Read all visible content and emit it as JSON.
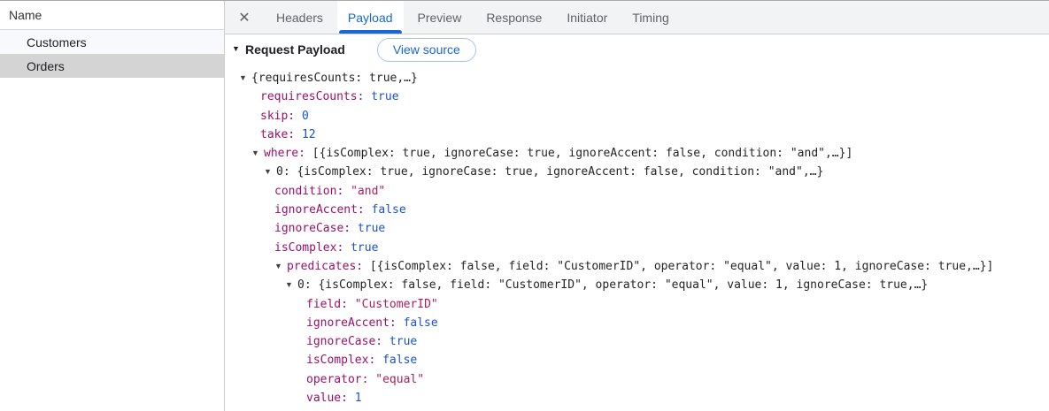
{
  "sidebar": {
    "header": "Name",
    "items": [
      {
        "label": "Customers",
        "selected": false
      },
      {
        "label": "Orders",
        "selected": true
      }
    ]
  },
  "tabs": {
    "items": [
      {
        "label": "Headers",
        "active": false
      },
      {
        "label": "Payload",
        "active": true
      },
      {
        "label": "Preview",
        "active": false
      },
      {
        "label": "Response",
        "active": false
      },
      {
        "label": "Initiator",
        "active": false
      },
      {
        "label": "Timing",
        "active": false
      }
    ]
  },
  "icons": {
    "close": "✕",
    "expanded_arrow": "▼"
  },
  "payload_section": {
    "title": "Request Payload",
    "view_source_label": "View source"
  },
  "colors": {
    "accent_blue": "#1967d2",
    "tree_key": "#99116d",
    "tree_string": "#b01e53",
    "tree_number_bool": "#1a53c8",
    "tree_plain": "#242424",
    "selected_row_bg": "#d4d4d4",
    "tabbar_bg": "#f1f3f4",
    "view_source_border": "#a3c6f5"
  },
  "payload_tree": {
    "rows": [
      {
        "indent": 16,
        "arrow": true,
        "parts": [
          {
            "text": "{requiresCounts: true,…}",
            "type": "plain"
          }
        ]
      },
      {
        "indent": 40,
        "arrow": false,
        "parts": [
          {
            "text": "requiresCounts: ",
            "type": "key"
          },
          {
            "text": "true",
            "type": "bool"
          }
        ]
      },
      {
        "indent": 40,
        "arrow": false,
        "parts": [
          {
            "text": "skip: ",
            "type": "key"
          },
          {
            "text": "0",
            "type": "num"
          }
        ]
      },
      {
        "indent": 40,
        "arrow": false,
        "parts": [
          {
            "text": "take: ",
            "type": "key"
          },
          {
            "text": "12",
            "type": "num"
          }
        ]
      },
      {
        "indent": 30,
        "arrow": true,
        "parts": [
          {
            "text": "where: ",
            "type": "key"
          },
          {
            "text": "[{isComplex: true, ignoreCase: true, ignoreAccent: false, condition: \"and\",…}]",
            "type": "plain"
          }
        ]
      },
      {
        "indent": 44,
        "arrow": true,
        "parts": [
          {
            "text": "0: {isComplex: true, ignoreCase: true, ignoreAccent: false, condition: \"and\",…}",
            "type": "plain"
          }
        ]
      },
      {
        "indent": 56,
        "arrow": false,
        "parts": [
          {
            "text": "condition: ",
            "type": "key"
          },
          {
            "text": "\"and\"",
            "type": "str"
          }
        ]
      },
      {
        "indent": 56,
        "arrow": false,
        "parts": [
          {
            "text": "ignoreAccent: ",
            "type": "key"
          },
          {
            "text": "false",
            "type": "bool"
          }
        ]
      },
      {
        "indent": 56,
        "arrow": false,
        "parts": [
          {
            "text": "ignoreCase: ",
            "type": "key"
          },
          {
            "text": "true",
            "type": "bool"
          }
        ]
      },
      {
        "indent": 56,
        "arrow": false,
        "parts": [
          {
            "text": "isComplex: ",
            "type": "key"
          },
          {
            "text": "true",
            "type": "bool"
          }
        ]
      },
      {
        "indent": 56,
        "arrow": true,
        "parts": [
          {
            "text": "predicates: ",
            "type": "key"
          },
          {
            "text": "[{isComplex: false, field: \"CustomerID\", operator: \"equal\", value: 1, ignoreCase: true,…}]",
            "type": "plain"
          }
        ]
      },
      {
        "indent": 68,
        "arrow": true,
        "parts": [
          {
            "text": "0: {isComplex: false, field: \"CustomerID\", operator: \"equal\", value: 1, ignoreCase: true,…}",
            "type": "plain"
          }
        ]
      },
      {
        "indent": 92,
        "arrow": false,
        "parts": [
          {
            "text": "field: ",
            "type": "key"
          },
          {
            "text": "\"CustomerID\"",
            "type": "str"
          }
        ]
      },
      {
        "indent": 92,
        "arrow": false,
        "parts": [
          {
            "text": "ignoreAccent: ",
            "type": "key"
          },
          {
            "text": "false",
            "type": "bool"
          }
        ]
      },
      {
        "indent": 92,
        "arrow": false,
        "parts": [
          {
            "text": "ignoreCase: ",
            "type": "key"
          },
          {
            "text": "true",
            "type": "bool"
          }
        ]
      },
      {
        "indent": 92,
        "arrow": false,
        "parts": [
          {
            "text": "isComplex: ",
            "type": "key"
          },
          {
            "text": "false",
            "type": "bool"
          }
        ]
      },
      {
        "indent": 92,
        "arrow": false,
        "parts": [
          {
            "text": "operator: ",
            "type": "key"
          },
          {
            "text": "\"equal\"",
            "type": "str"
          }
        ]
      },
      {
        "indent": 92,
        "arrow": false,
        "parts": [
          {
            "text": "value: ",
            "type": "key"
          },
          {
            "text": "1",
            "type": "num"
          }
        ]
      }
    ]
  }
}
